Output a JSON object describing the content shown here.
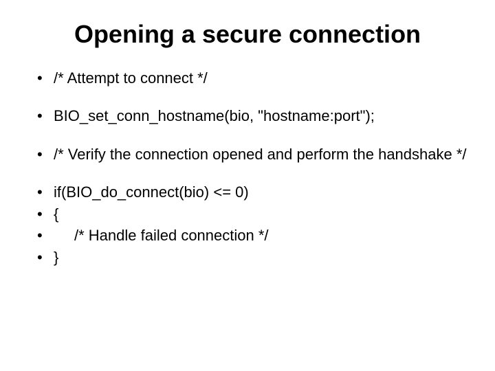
{
  "title": "Opening a secure connection",
  "bullets": {
    "b0": "/* Attempt to connect */",
    "b1": "BIO_set_conn_hostname(bio, \"hostname:port\");",
    "b2": "/* Verify the connection opened and perform the handshake */",
    "b3": "if(BIO_do_connect(bio) <= 0)",
    "b4": "{",
    "b5_prefix": "",
    "b5": "/* Handle failed connection */",
    "b6": "}"
  }
}
